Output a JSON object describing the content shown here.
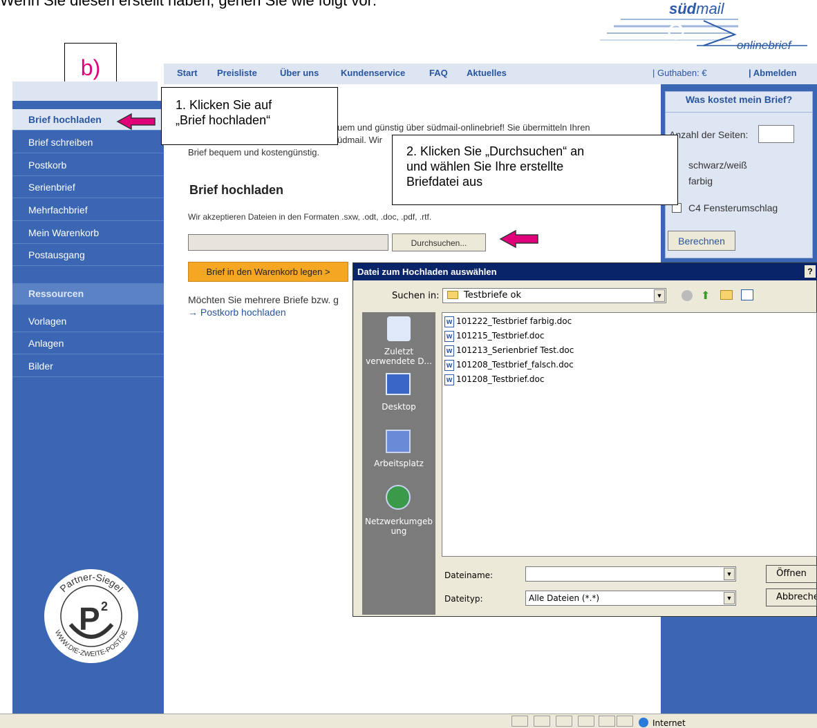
{
  "intro": "Wenn Sie diesen erstellt haben, gehen Sie wie folgt vor:",
  "logo": {
    "brand_bold": "süd",
    "brand_rest": "mail",
    "sub": "onlinebrief"
  },
  "step_label": "b)",
  "topnav": {
    "items": [
      "Start",
      "Preisliste",
      "Über uns",
      "Kundenservice",
      "FAQ",
      "Aktuelles"
    ],
    "guthaben": "| Guthaben: €",
    "abmelden": "| Abmelden"
  },
  "sidebar": {
    "items": [
      "Brief hochladen",
      "Brief schreiben",
      "Postkorb",
      "Serienbrief",
      "Mehrfachbrief",
      "Mein Warenkorb",
      "Postausgang"
    ],
    "section": "Ressourcen",
    "res_items": [
      "Vorlagen",
      "Anlagen",
      "Bilder"
    ]
  },
  "seal": {
    "top": "Partner-Siegel",
    "bottom": "WWW.DIE-ZWEITE-POST.DE",
    "mark": "P",
    "sup": "2"
  },
  "main": {
    "intro_line1": "uem und günstig über südmail-onlinebrief! Sie übermitteln Ihren",
    "intro_line2": "üdmail. Wir",
    "intro_line3": "Brief bequem und kostengünstig.",
    "heading": "Brief hochladen",
    "formats": "Wir akzeptieren Dateien in den Formaten .sxw, .odt, .doc, .pdf, .rtf.",
    "browse": "Durchsuchen...",
    "cart_button": "Brief in den Warenkorb legen >",
    "multi_text": "Möchten Sie mehrere Briefe bzw. g",
    "postkorb_link": "→ Postkorb hochladen"
  },
  "calc": {
    "title": "Was kostet mein Brief?",
    "pages_label": "Anzahl der Seiten:",
    "bw": "schwarz/weiß",
    "color": "farbig",
    "envelope": "C4 Fensterumschlag",
    "button": "Berechnen"
  },
  "callouts": {
    "one_line1": "1. Klicken Sie auf",
    "one_line2": "„Brief hochladen“",
    "two_line1": "2. Klicken Sie „Durchsuchen“ an",
    "two_line2": "und  wählen Sie Ihre erstellte",
    "two_line3": "Briefdatei aus"
  },
  "dialog": {
    "title": "Datei zum Hochladen auswählen",
    "help": "?",
    "lookin_label": "Suchen in:",
    "folder": "Testbriefe ok",
    "places": [
      {
        "icon": "recent-icon",
        "label1": "Zuletzt",
        "label2": "verwendete D..."
      },
      {
        "icon": "desktop-icon",
        "label1": "Desktop",
        "label2": ""
      },
      {
        "icon": "computer-icon",
        "label1": "Arbeitsplatz",
        "label2": ""
      },
      {
        "icon": "network-icon",
        "label1": "Netzwerkumgeb",
        "label2": "ung"
      }
    ],
    "files": [
      "101222_Testbrief farbig.doc",
      "101215_Testbrief.doc",
      "101213_Serienbrief Test.doc",
      "101208_Testbrief_falsch.doc",
      "101208_Testbrief.doc"
    ],
    "filename_label": "Dateiname:",
    "filetype_label": "Dateityp:",
    "filetype_value": "Alle Dateien (*.*)",
    "open": "Öffnen",
    "cancel": "Abbrechen"
  },
  "statusbar": {
    "zone": "Internet"
  },
  "colors": {
    "sidebar": "#3a66b3",
    "accent": "#e0007a",
    "cart": "#f5a623",
    "dialog_title": "#0a246a"
  }
}
